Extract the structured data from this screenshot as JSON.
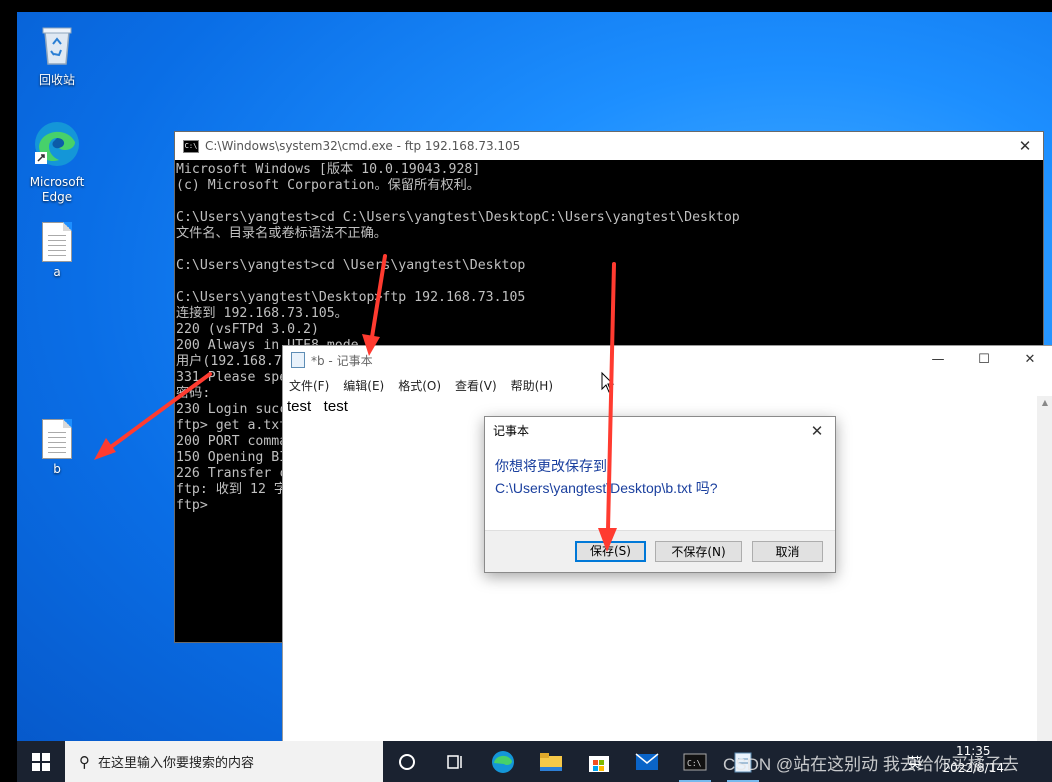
{
  "desktop": {
    "icons": [
      {
        "label": "回收站",
        "icon": "recycle-bin-icon"
      },
      {
        "label": "Microsoft Edge",
        "icon": "edge-icon"
      },
      {
        "label": "a",
        "icon": "text-file-icon"
      },
      {
        "label": "b",
        "icon": "text-file-icon"
      }
    ]
  },
  "cmd": {
    "title": "C:\\Windows\\system32\\cmd.exe - ftp  192.168.73.105",
    "lines": [
      "Microsoft Windows [版本 10.0.19043.928]",
      "(c) Microsoft Corporation。保留所有权利。",
      "",
      "C:\\Users\\yangtest>cd C:\\Users\\yangtest\\DesktopC:\\Users\\yangtest\\Desktop",
      "文件名、目录名或卷标语法不正确。",
      "",
      "C:\\Users\\yangtest>cd \\Users\\yangtest\\Desktop",
      "",
      "C:\\Users\\yangtest\\Desktop>ftp 192.168.73.105",
      "连接到 192.168.73.105。",
      "220 (vsFTPd 3.0.2)",
      "200 Always in UTF8 mode.",
      "用户(192.168.7",
      "331 Please spe",
      "密码:",
      "230 Login succ",
      "ftp> get a.txt",
      "200 PORT comma",
      "150 Opening BI",
      "226 Transfer c",
      "ftp: 收到 12 字",
      "ftp>"
    ]
  },
  "notepad": {
    "title": "*b - 记事本",
    "menu": [
      "文件(F)",
      "编辑(E)",
      "格式(O)",
      "查看(V)",
      "帮助(H)"
    ],
    "content": "test   test"
  },
  "dialog": {
    "title": "记事本",
    "message_line1": "你想将更改保存到",
    "message_line2": "C:\\Users\\yangtest\\Desktop\\b.txt 吗?",
    "buttons": {
      "save": "保存(S)",
      "dont_save": "不保存(N)",
      "cancel": "取消"
    }
  },
  "taskbar": {
    "search_placeholder": "在这里输入你要搜索的内容",
    "apps": [
      "task-view-icon",
      "edge-icon",
      "file-explorer-icon",
      "store-icon",
      "mail-icon",
      "cmd-icon",
      "notepad-icon"
    ],
    "ime": "英",
    "time": "11:35",
    "date": "2022/8/14"
  },
  "watermark": "CSDN @站在这别动 我去给你买橘子去",
  "colors": {
    "desktop": "#1d8fff",
    "accent": "#0078d7",
    "dialog_text": "#1a3f9e",
    "arrow": "#ff3b30"
  }
}
